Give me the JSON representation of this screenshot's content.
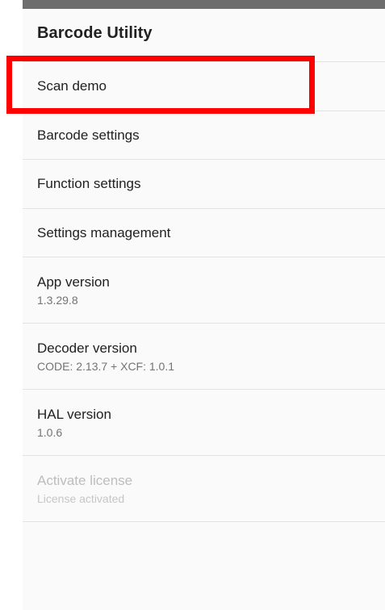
{
  "app_bar": {
    "title": "Barcode Utility"
  },
  "preferences": [
    {
      "title": "Scan demo",
      "summary": ""
    },
    {
      "title": "Barcode settings",
      "summary": ""
    },
    {
      "title": "Function settings",
      "summary": ""
    },
    {
      "title": "Settings management",
      "summary": ""
    },
    {
      "title": "App version",
      "summary": "1.3.29.8"
    },
    {
      "title": "Decoder version",
      "summary": "CODE: 2.13.7 + XCF: 1.0.1"
    },
    {
      "title": "HAL version",
      "summary": "1.0.6"
    },
    {
      "title": "Activate license",
      "summary": "License activated",
      "enabled": false
    }
  ],
  "colors": {
    "highlight": "#ff0000",
    "primary_text": "#212121",
    "secondary_text": "#737373",
    "disabled_text": "#bdbdbd",
    "divider": "#e3e3e3",
    "background": "#fafafa",
    "status_strip": "#6e6e6e"
  }
}
